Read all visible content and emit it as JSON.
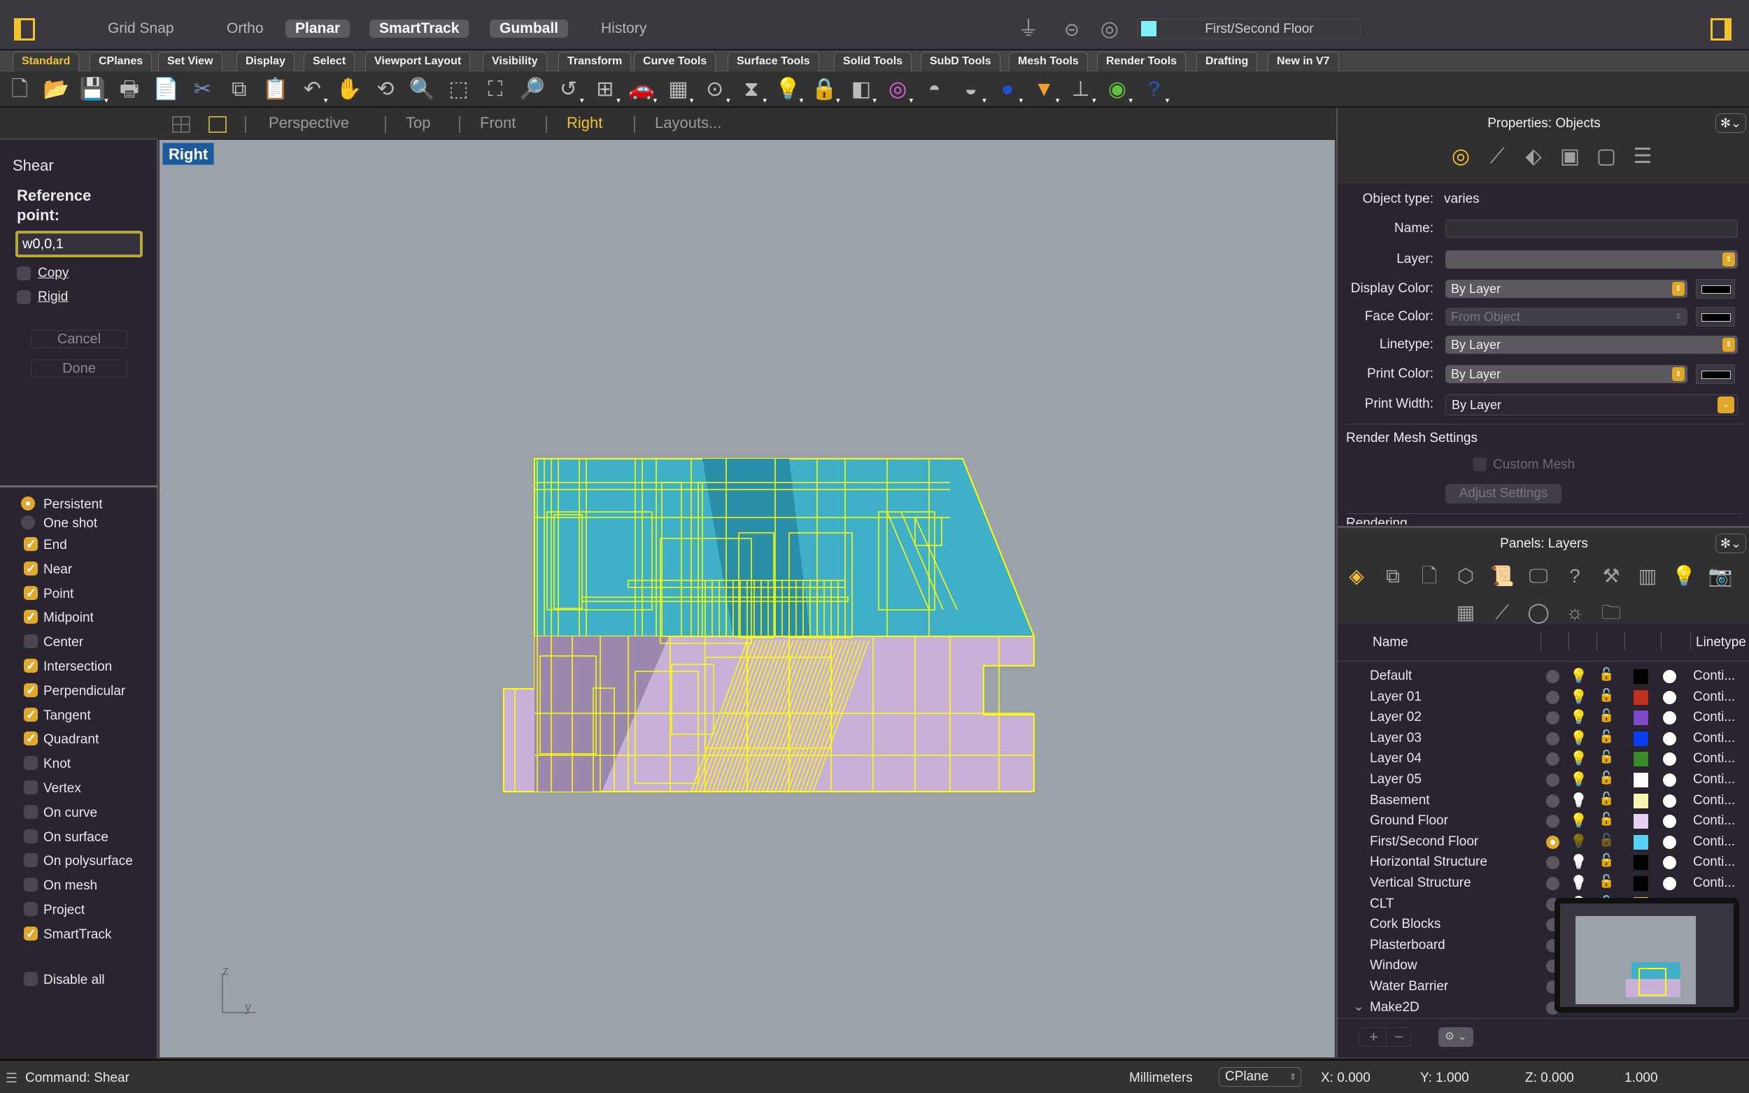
{
  "topbar": {
    "modes": [
      {
        "label": "Grid Snap",
        "active": false
      },
      {
        "label": "Ortho",
        "active": false
      },
      {
        "label": "Planar",
        "active": true
      },
      {
        "label": "SmartTrack",
        "active": true
      },
      {
        "label": "Gumball",
        "active": true
      },
      {
        "label": "History",
        "active": false
      }
    ],
    "icons": [
      "filter-icon",
      "osnap-icon",
      "record-icon"
    ],
    "current_layer": "First/Second Floor",
    "current_layer_color": "#80f0f8"
  },
  "tabs": [
    "Standard",
    "CPlanes",
    "Set View",
    "Display",
    "Select",
    "Viewport Layout",
    "Visibility",
    "Transform",
    "Curve Tools",
    "Surface Tools",
    "Solid Tools",
    "SubD Tools",
    "Mesh Tools",
    "Render Tools",
    "Drafting",
    "New in V7"
  ],
  "active_tab": "Standard",
  "toolbar_icons": [
    {
      "name": "new-file",
      "glyph": "🗋",
      "dd": false
    },
    {
      "name": "open-folder",
      "glyph": "📂",
      "dd": false
    },
    {
      "name": "save",
      "glyph": "💾",
      "dd": true
    },
    {
      "name": "print",
      "glyph": "🖶",
      "dd": false
    },
    {
      "name": "import",
      "glyph": "📄",
      "dd": false
    },
    {
      "name": "cut",
      "glyph": "✂",
      "dd": false
    },
    {
      "name": "copy",
      "glyph": "⧉",
      "dd": false
    },
    {
      "name": "paste",
      "glyph": "📋",
      "dd": false
    },
    {
      "name": "undo",
      "glyph": "↶",
      "dd": true
    },
    {
      "name": "pan-hand",
      "glyph": "✋",
      "dd": false
    },
    {
      "name": "rotate-view",
      "glyph": "⟲",
      "dd": false
    },
    {
      "name": "zoom-dynamic",
      "glyph": "🔍",
      "dd": false
    },
    {
      "name": "zoom-window",
      "glyph": "⬚",
      "dd": false
    },
    {
      "name": "zoom-extents",
      "glyph": "⛶",
      "dd": false
    },
    {
      "name": "zoom-selected",
      "glyph": "🔎",
      "dd": false
    },
    {
      "name": "undo-view",
      "glyph": "↺",
      "dd": true
    },
    {
      "name": "viewport-layout",
      "glyph": "⊞",
      "dd": true
    },
    {
      "name": "car-shaded",
      "glyph": "🚗",
      "dd": true
    },
    {
      "name": "cplane",
      "glyph": "▦",
      "dd": true
    },
    {
      "name": "osnap",
      "glyph": "⊙",
      "dd": true
    },
    {
      "name": "select-filter",
      "glyph": "⧗",
      "dd": true
    },
    {
      "name": "light-bulb",
      "glyph": "💡",
      "dd": true
    },
    {
      "name": "lock",
      "glyph": "🔒",
      "dd": true
    },
    {
      "name": "layers-color",
      "glyph": "◧",
      "dd": true
    },
    {
      "name": "color-wheel",
      "glyph": "◎",
      "dd": true
    },
    {
      "name": "sphere-wire",
      "glyph": "◓",
      "dd": false
    },
    {
      "name": "sphere-grid",
      "glyph": "◒",
      "dd": true
    },
    {
      "name": "render-sphere",
      "glyph": "●",
      "dd": true
    },
    {
      "name": "spotlight",
      "glyph": "▼",
      "dd": true
    },
    {
      "name": "dimension",
      "glyph": "⊥",
      "dd": true
    },
    {
      "name": "grasshopper",
      "glyph": "◉",
      "dd": true
    },
    {
      "name": "help",
      "glyph": "?",
      "dd": true
    }
  ],
  "command_panel": {
    "title": "Shear",
    "prompt": "Reference point:",
    "input_value": "w0,0,1",
    "options": [
      {
        "label": "Copy",
        "checked": false
      },
      {
        "label": "Rigid",
        "checked": false
      }
    ],
    "cancel_label": "Cancel",
    "done_label": "Done"
  },
  "osnap": {
    "modes": [
      {
        "label": "Persistent",
        "selected": true
      },
      {
        "label": "One shot",
        "selected": false
      }
    ],
    "snaps": [
      {
        "label": "End",
        "checked": true
      },
      {
        "label": "Near",
        "checked": true
      },
      {
        "label": "Point",
        "checked": true
      },
      {
        "label": "Midpoint",
        "checked": true
      },
      {
        "label": "Center",
        "checked": false
      },
      {
        "label": "Intersection",
        "checked": true
      },
      {
        "label": "Perpendicular",
        "checked": true
      },
      {
        "label": "Tangent",
        "checked": true
      },
      {
        "label": "Quadrant",
        "checked": true
      },
      {
        "label": "Knot",
        "checked": false
      },
      {
        "label": "Vertex",
        "checked": false
      },
      {
        "label": "On curve",
        "checked": false
      },
      {
        "label": "On surface",
        "checked": false
      },
      {
        "label": "On polysurface",
        "checked": false
      },
      {
        "label": "On mesh",
        "checked": false
      },
      {
        "label": "Project",
        "checked": false
      },
      {
        "label": "SmartTrack",
        "checked": true
      }
    ],
    "disable_all": {
      "label": "Disable all",
      "checked": false
    }
  },
  "viewport_tabs": {
    "tabs": [
      "Perspective",
      "Top",
      "Front",
      "Right",
      "Layouts..."
    ],
    "active": "Right"
  },
  "viewport": {
    "label": "Right",
    "axis_vertical": "z",
    "axis_horizontal": "y"
  },
  "properties": {
    "title": "Properties: Objects",
    "rows": {
      "object_type_label": "Object type:",
      "object_type_value": "varies",
      "name_label": "Name:",
      "name_value": "",
      "layer_label": "Layer:",
      "layer_value": "",
      "display_color_label": "Display Color:",
      "display_color_value": "By Layer",
      "face_color_label": "Face Color:",
      "face_color_value": "From Object",
      "linetype_label": "Linetype:",
      "linetype_value": "By Layer",
      "print_color_label": "Print Color:",
      "print_color_value": "By Layer",
      "print_width_label": "Print Width:",
      "print_width_value": "By Layer"
    },
    "render_mesh_section": "Render Mesh Settings",
    "custom_mesh_label": "Custom Mesh",
    "adjust_settings_label": "Adjust Settings",
    "rendering_section": "Rendering"
  },
  "layers_panel": {
    "title": "Panels: Layers",
    "col_name": "Name",
    "col_linetype": "Linetype",
    "layers": [
      {
        "name": "Default",
        "color": "#000000",
        "current": false,
        "on": true,
        "locked": false,
        "linetype": "Conti..."
      },
      {
        "name": "Layer 01",
        "color": "#c0301e",
        "current": false,
        "on": true,
        "locked": false,
        "linetype": "Conti..."
      },
      {
        "name": "Layer 02",
        "color": "#7e48c8",
        "current": false,
        "on": true,
        "locked": false,
        "linetype": "Conti..."
      },
      {
        "name": "Layer 03",
        "color": "#0a3ef0",
        "current": false,
        "on": true,
        "locked": false,
        "linetype": "Conti..."
      },
      {
        "name": "Layer 04",
        "color": "#3a8a2a",
        "current": false,
        "on": true,
        "locked": false,
        "linetype": "Conti..."
      },
      {
        "name": "Layer 05",
        "color": "#ffffff",
        "current": false,
        "on": true,
        "locked": false,
        "linetype": "Conti..."
      },
      {
        "name": "Basement",
        "color": "#f6f6b0",
        "current": false,
        "on": false,
        "locked": false,
        "linetype": "Conti..."
      },
      {
        "name": "Ground Floor",
        "color": "#e8d0f4",
        "current": false,
        "on": true,
        "locked": false,
        "linetype": "Conti..."
      },
      {
        "name": "First/Second Floor",
        "color": "#58d0f4",
        "current": true,
        "on": true,
        "locked": false,
        "linetype": "Conti..."
      },
      {
        "name": "Horizontal Structure",
        "color": "#000000",
        "current": false,
        "on": false,
        "locked": false,
        "linetype": "Conti..."
      },
      {
        "name": "Vertical Structure",
        "color": "#000000",
        "current": false,
        "on": false,
        "locked": false,
        "linetype": "Conti..."
      },
      {
        "name": "CLT",
        "color": "#f0c040",
        "current": false,
        "on": false,
        "locked": false,
        "linetype": "Conti..."
      },
      {
        "name": "Cork Blocks",
        "color": "",
        "current": false,
        "on": true,
        "locked": false,
        "linetype": ""
      },
      {
        "name": "Plasterboard",
        "color": "",
        "current": false,
        "on": true,
        "locked": false,
        "linetype": ""
      },
      {
        "name": "Window",
        "color": "",
        "current": false,
        "on": true,
        "locked": false,
        "linetype": ""
      },
      {
        "name": "Water Barrier",
        "color": "",
        "current": false,
        "on": true,
        "locked": false,
        "linetype": ""
      },
      {
        "name": "Make2D",
        "color": "",
        "current": false,
        "on": true,
        "locked": false,
        "linetype": "",
        "expandable": true
      }
    ],
    "add_label": "+",
    "remove_label": "−"
  },
  "statusbar": {
    "command": "Command: Shear",
    "units": "Millimeters",
    "cplane": "CPlane",
    "x": "X: 0.000",
    "y": "Y: 1.000",
    "z": "Z: 0.000",
    "distance": "1.000"
  }
}
